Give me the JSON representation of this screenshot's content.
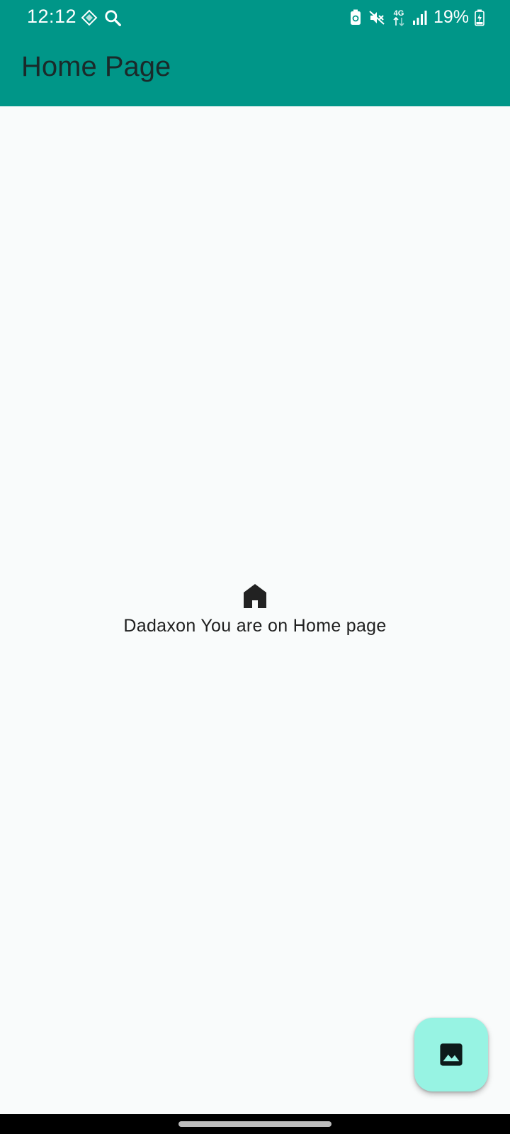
{
  "status_bar": {
    "time": "12:12",
    "battery": "19%",
    "network": "4G",
    "icons": [
      "app-notification-icon",
      "search-icon",
      "battery-saver-icon",
      "mute-icon",
      "network-4g-icon",
      "signal-icon",
      "battery-charging-icon"
    ]
  },
  "app_bar": {
    "title": "Home Page"
  },
  "main": {
    "icon": "home-icon",
    "message": "Dadaxon You are on Home page"
  },
  "fab": {
    "icon": "image-icon"
  },
  "colors": {
    "primary": "#009688",
    "fab": "#97f3e3",
    "background": "#f9fbfb"
  }
}
